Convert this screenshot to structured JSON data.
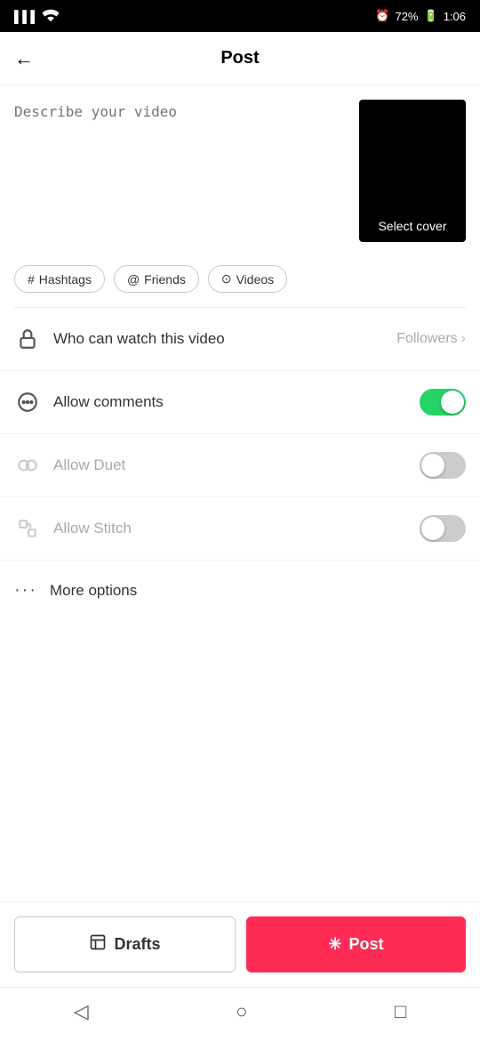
{
  "statusBar": {
    "signal": "3G",
    "wifi": "wifi",
    "alarm": "⏰",
    "battery": "72%",
    "time": "1:06"
  },
  "header": {
    "title": "Post",
    "back_label": "←"
  },
  "videoSection": {
    "placeholder": "Describe your video",
    "selectCover": "Select cover"
  },
  "tags": [
    {
      "icon": "#",
      "label": "Hashtags"
    },
    {
      "icon": "@",
      "label": "Friends"
    },
    {
      "icon": "▶",
      "label": "Videos"
    }
  ],
  "options": [
    {
      "id": "who-watch",
      "label": "Who can watch this video",
      "value": "Followers",
      "type": "navigate",
      "muted": false,
      "icon": "lock"
    },
    {
      "id": "allow-comments",
      "label": "Allow comments",
      "value": "",
      "type": "toggle",
      "toggleOn": true,
      "muted": false,
      "icon": "comment"
    },
    {
      "id": "allow-duet",
      "label": "Allow Duet",
      "value": "",
      "type": "toggle",
      "toggleOn": false,
      "muted": true,
      "icon": "duet"
    },
    {
      "id": "allow-stitch",
      "label": "Allow Stitch",
      "value": "",
      "type": "toggle",
      "toggleOn": false,
      "muted": true,
      "icon": "stitch"
    }
  ],
  "moreOptions": {
    "label": "More options"
  },
  "bottomButtons": {
    "drafts": "Drafts",
    "post": "Post"
  }
}
